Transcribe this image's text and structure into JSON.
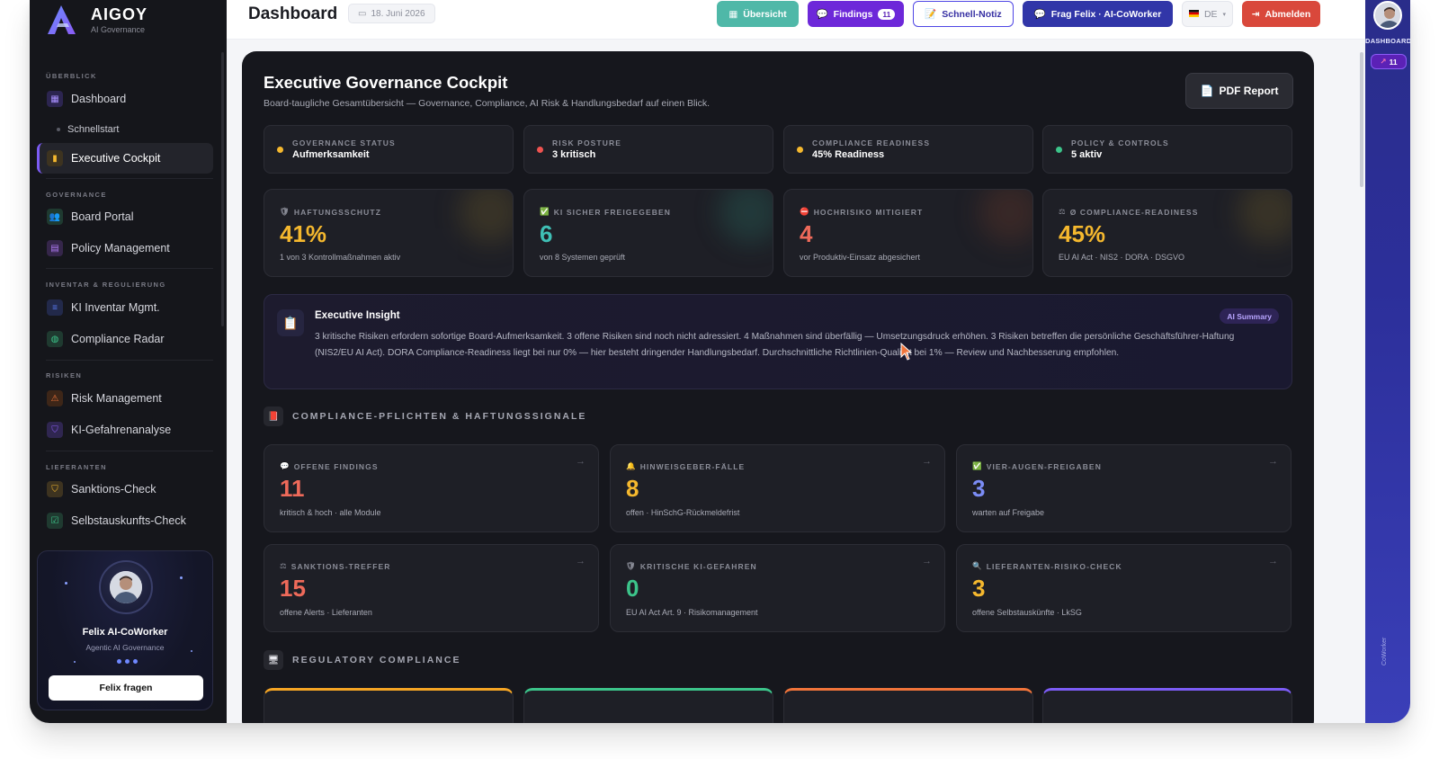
{
  "brand": {
    "name": "AIGOY",
    "subtitle": "AI Governance"
  },
  "sidebar": {
    "sections": [
      {
        "label": "ÜBERBLICK"
      },
      {
        "label": "GOVERNANCE"
      },
      {
        "label": "INVENTAR & REGULIERUNG"
      },
      {
        "label": "RISIKEN"
      },
      {
        "label": "LIEFERANTEN"
      }
    ],
    "items": [
      {
        "label": "Dashboard",
        "color": "#7c5cf5"
      },
      {
        "label": "Schnellstart"
      },
      {
        "label": "Executive Cockpit",
        "color": "#f5b82e",
        "active": true
      },
      {
        "label": "Board Portal",
        "color": "#3cc48a"
      },
      {
        "label": "Policy Management",
        "color": "#b07cf5"
      },
      {
        "label": "KI Inventar Mgmt.",
        "color": "#5b7cf5"
      },
      {
        "label": "Compliance Radar",
        "color": "#3cc48a"
      },
      {
        "label": "Risk Management",
        "color": "#f0743a"
      },
      {
        "label": "KI-Gefahrenanalyse",
        "color": "#8b5cf6"
      },
      {
        "label": "Sanktions-Check",
        "color": "#f5b82e"
      },
      {
        "label": "Selbstauskunfts-Check",
        "color": "#3cc48a"
      }
    ],
    "felix": {
      "name": "Felix AI-CoWorker",
      "role": "Agentic AI Governance",
      "button": "Felix fragen"
    }
  },
  "topbar": {
    "title": "Dashboard",
    "date": "18. Juni 2026",
    "buttons": {
      "uebersicht": "Übersicht",
      "findings": "Findings",
      "findings_count": "11",
      "notiz": "Schnell-Notiz",
      "felix": "Frag Felix · AI-CoWorker",
      "lang": "DE",
      "logout": "Abmelden"
    }
  },
  "cockpit": {
    "title": "Executive Governance Cockpit",
    "subtitle": "Board-taugliche Gesamtübersicht — Governance, Compliance, AI Risk & Handlungsbedarf auf einen Blick.",
    "pdf_button": "PDF Report",
    "status": [
      {
        "label": "GOVERNANCE STATUS",
        "value": "Aufmerksamkeit",
        "color": "#f5b82e"
      },
      {
        "label": "RISK POSTURE",
        "value": "3 kritisch",
        "color": "#ef5350"
      },
      {
        "label": "COMPLIANCE READINESS",
        "value": "45% Readiness",
        "color": "#f5b82e"
      },
      {
        "label": "POLICY & CONTROLS",
        "value": "5 aktiv",
        "color": "#3cc48a"
      }
    ],
    "kpis": [
      {
        "icon": "🛡",
        "label": "HAFTUNGSSCHUTZ",
        "value": "41%",
        "foot": "1 von 3 Kontrollmaßnahmen aktiv",
        "color": "#f5b82e"
      },
      {
        "icon": "✅",
        "label": "KI SICHER FREIGEGEBEN",
        "value": "6",
        "foot": "von 8 Systemen geprüft",
        "color": "#3fbfb5"
      },
      {
        "icon": "⛔",
        "label": "HOCHRISIKO MITIGIERT",
        "value": "4",
        "foot": "vor Produktiv-Einsatz abgesichert",
        "color": "#ef6a5a"
      },
      {
        "icon": "⚖",
        "label": "Ø COMPLIANCE-READINESS",
        "value": "45%",
        "foot": "EU AI Act · NIS2 · DORA · DSGVO",
        "color": "#f5b82e"
      }
    ],
    "insight": {
      "title": "Executive Insight",
      "badge": "AI Summary",
      "text": "3 kritische Risiken erfordern sofortige Board-Aufmerksamkeit. 3 offene Risiken sind noch nicht adressiert. 4 Maßnahmen sind überfällig — Umsetzungsdruck erhöhen. 3 Risiken betreffen die persönliche Geschäftsführer-Haftung (NIS2/EU AI Act). DORA Compliance-Readiness liegt bei nur 0% — hier besteht dringender Handlungsbedarf. Durchschnittliche Richtlinien-Qualität bei 1% — Review und Nachbesserung empfohlen."
    },
    "section_signals": "COMPLIANCE-PFLICHTEN & HAFTUNGSSIGNALE",
    "signals": [
      {
        "icon": "💬",
        "label": "OFFENE FINDINGS",
        "value": "11",
        "foot": "kritisch & hoch · alle Module",
        "color": "#ef6a5a"
      },
      {
        "icon": "🔔",
        "label": "HINWEISGEBER-FÄLLE",
        "value": "8",
        "foot": "offen · HinSchG-Rückmeldefrist",
        "color": "#f5b82e"
      },
      {
        "icon": "✅",
        "label": "VIER-AUGEN-FREIGABEN",
        "value": "3",
        "foot": "warten auf Freigabe",
        "color": "#7b8cf5"
      },
      {
        "icon": "⚖",
        "label": "SANKTIONS-TREFFER",
        "value": "15",
        "foot": "offene Alerts · Lieferanten",
        "color": "#ef6a5a"
      },
      {
        "icon": "🛡",
        "label": "KRITISCHE KI-GEFAHREN",
        "value": "0",
        "foot": "EU AI Act Art. 9 · Risikomanagement",
        "color": "#3cc48a"
      },
      {
        "icon": "🔍",
        "label": "LIEFERANTEN-RISIKO-CHECK",
        "value": "3",
        "foot": "offene Selbstauskünfte · LkSG",
        "color": "#f5b82e"
      }
    ],
    "section_regulatory": "REGULATORY COMPLIANCE",
    "regulatory_colors": [
      "#f5a524",
      "#3cc48a",
      "#f0743a",
      "#7c5cf5"
    ]
  },
  "rail": {
    "label": "DASHBOARD",
    "badge": "11",
    "vertical": "CoWorker"
  }
}
